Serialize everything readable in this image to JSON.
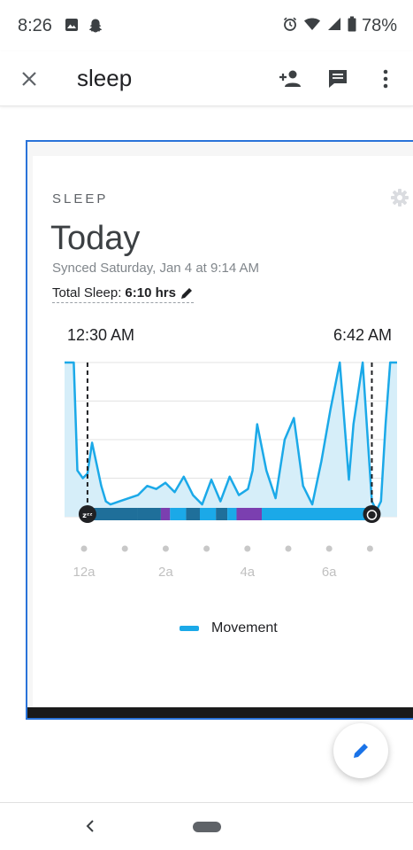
{
  "status_bar": {
    "time": "8:26",
    "battery_percent": "78%",
    "icons_left": [
      "image-icon",
      "snapchat-icon"
    ],
    "icons_right": [
      "alarm-icon",
      "wifi-icon",
      "signal-icon",
      "battery-icon"
    ]
  },
  "app_bar": {
    "title": "sleep",
    "actions": [
      "add-person-icon",
      "comment-icon",
      "more-vert-icon"
    ]
  },
  "card": {
    "label": "SLEEP",
    "heading": "Today",
    "synced": "Synced Saturday, Jan 4 at 9:14 AM",
    "total_sleep_label": "Total Sleep:",
    "total_sleep_value": "6:10 hrs",
    "start_time": "12:30 AM",
    "end_time": "6:42 AM",
    "legend_label": "Movement"
  },
  "colors": {
    "movement_line": "#1ba9e8",
    "movement_fill": "#d6eef9",
    "stage_dark": "#1f6f9a",
    "stage_light": "#1ba9e8",
    "stage_awake": "#7b3fb0",
    "frame_border": "#2a73d9",
    "fab_icon": "#1a73e8"
  },
  "chart_data": {
    "type": "area",
    "x_ticks": [
      "12a",
      "2a",
      "4a",
      "6a"
    ],
    "series": [
      {
        "name": "Movement",
        "x_hours": [
          0.0,
          0.1,
          0.15,
          0.2,
          0.28,
          0.4,
          0.5,
          0.6,
          0.7,
          0.8,
          0.9,
          1.0,
          1.2,
          1.4,
          1.6,
          1.8,
          2.0,
          2.2,
          2.4,
          2.6,
          2.8,
          3.0,
          3.2,
          3.4,
          3.6,
          3.8,
          4.0,
          4.1,
          4.2,
          4.4,
          4.6,
          4.8,
          5.0,
          5.2,
          5.4,
          5.6,
          5.8,
          6.0,
          6.2,
          6.3,
          6.5,
          6.7,
          6.8,
          6.9,
          7.0,
          7.1,
          7.25
        ],
        "values": [
          100,
          100,
          100,
          100,
          30,
          25,
          28,
          48,
          34,
          20,
          10,
          8,
          10,
          12,
          14,
          20,
          18,
          22,
          16,
          26,
          14,
          8,
          24,
          10,
          26,
          14,
          18,
          30,
          60,
          30,
          12,
          50,
          64,
          20,
          8,
          36,
          70,
          100,
          24,
          60,
          100,
          10,
          4,
          10,
          60,
          100,
          100
        ]
      }
    ],
    "sleep_stages": [
      {
        "start": 0.5,
        "end": 1.6,
        "stage": "deep"
      },
      {
        "start": 1.6,
        "end": 2.1,
        "stage": "deep"
      },
      {
        "start": 2.1,
        "end": 2.3,
        "stage": "awake"
      },
      {
        "start": 2.3,
        "end": 2.65,
        "stage": "light"
      },
      {
        "start": 2.65,
        "end": 2.95,
        "stage": "deep"
      },
      {
        "start": 2.95,
        "end": 3.3,
        "stage": "light"
      },
      {
        "start": 3.3,
        "end": 3.55,
        "stage": "deep"
      },
      {
        "start": 3.55,
        "end": 3.75,
        "stage": "light"
      },
      {
        "start": 3.75,
        "end": 4.3,
        "stage": "awake"
      },
      {
        "start": 4.3,
        "end": 6.7,
        "stage": "light"
      }
    ],
    "grid": true
  }
}
